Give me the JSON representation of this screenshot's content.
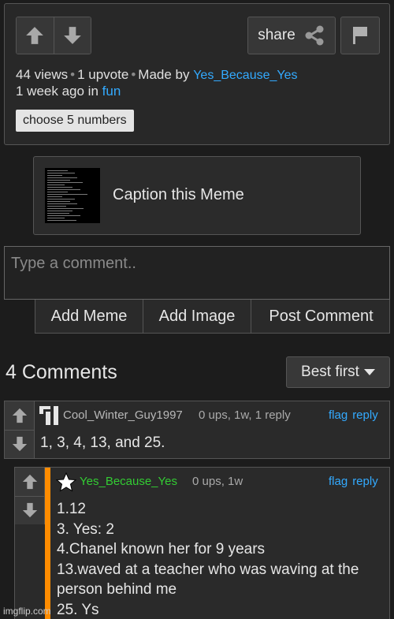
{
  "post": {
    "share_label": "share",
    "views": "44 views",
    "upvotes": "1 upvote",
    "made_by_prefix": "Made by",
    "author": "Yes_Because_Yes",
    "time_prefix": "1 week ago in",
    "stream": "fun",
    "title": "choose 5 numbers"
  },
  "caption": {
    "label": "Caption this Meme"
  },
  "comment_box": {
    "placeholder": "Type a comment..",
    "add_meme": "Add Meme",
    "add_image": "Add Image",
    "post_comment": "Post Comment"
  },
  "comments_header": {
    "count": "4 Comments",
    "sort": "Best first"
  },
  "comments": [
    {
      "user": "Cool_Winter_Guy1997",
      "stats": "0 ups, 1w, 1 reply",
      "flag": "flag",
      "reply": "reply",
      "body": "1, 3, 4, 13, and 25."
    },
    {
      "user": "Yes_Because_Yes",
      "stats": "0 ups, 1w",
      "flag": "flag",
      "reply": "reply",
      "body": "1.12\n3. Yes: 2\n4.Chanel known her for 9 years\n13.waved at a teacher who was waving at the person behind me\n25. Ys"
    }
  ],
  "watermark": "imgflip.com",
  "colors": {
    "link": "#33aaff",
    "op_username": "#33cc33",
    "op_bar": "#ff8c00"
  }
}
